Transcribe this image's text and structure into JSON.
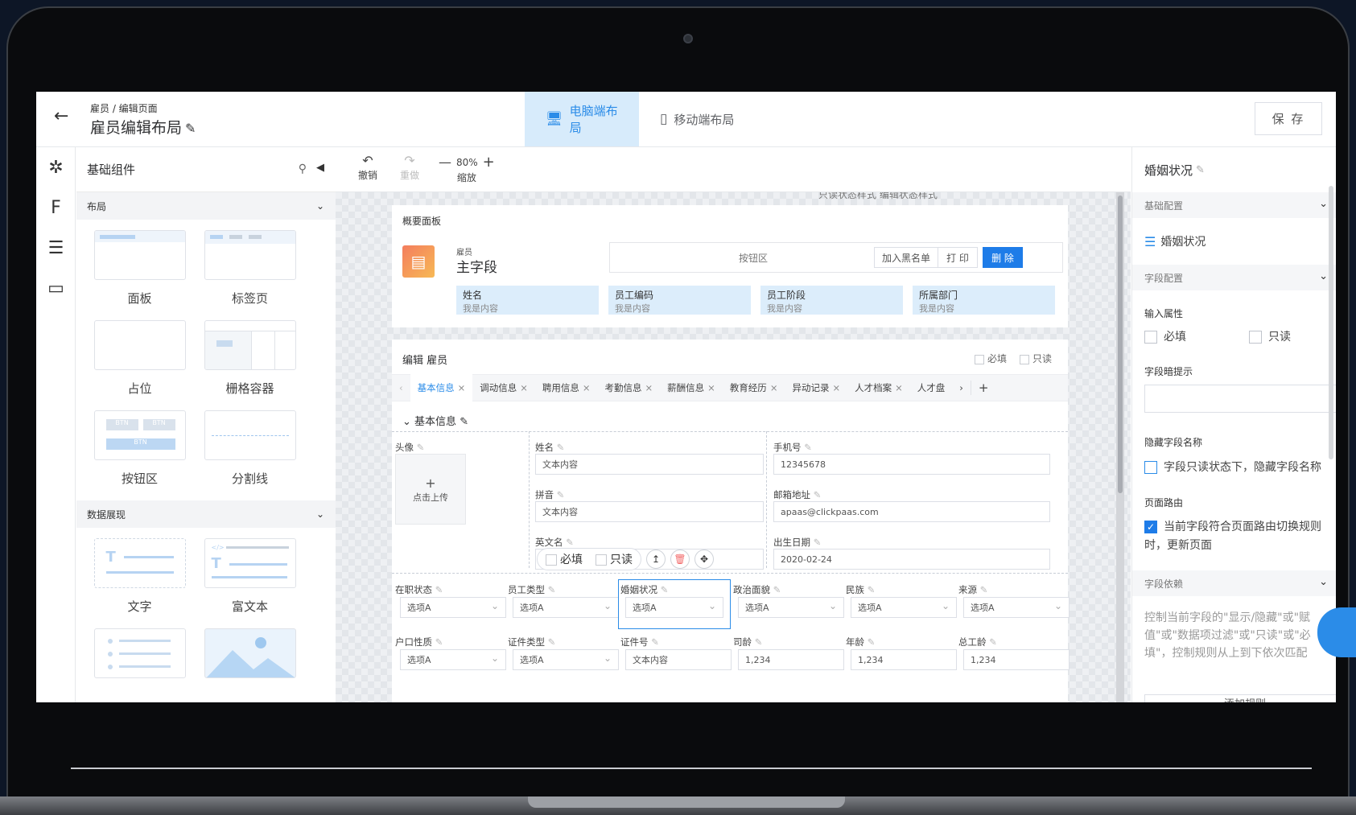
{
  "header": {
    "breadcrumb": "雇员 / 编辑页面",
    "title": "雇员编辑布局",
    "tabs": [
      {
        "label": "电脑端布局",
        "active": true
      },
      {
        "label": "移动端布局",
        "active": false
      }
    ],
    "save_label": "保 存"
  },
  "left_panel": {
    "title": "基础组件",
    "sections": [
      {
        "label": "布局",
        "items": [
          "面板",
          "标签页",
          "占位",
          "栅格容器",
          "按钮区",
          "分割线"
        ]
      },
      {
        "label": "数据展现",
        "items": [
          "文字",
          "富文本",
          "",
          ""
        ]
      }
    ]
  },
  "toolbar": {
    "undo": "撤销",
    "redo": "重做",
    "zoom_value": "80%",
    "zoom_label": "缩放"
  },
  "canvas": {
    "style_toggle": "只读状态样式   编辑状态样式",
    "overview": {
      "title": "概要面板",
      "entity": "雇员",
      "main_field": "主字段",
      "button_area": "按钮区",
      "buttons": [
        "加入黑名单",
        "打 印",
        "删 除"
      ],
      "fields": [
        {
          "label": "姓名",
          "value": "我是内容"
        },
        {
          "label": "员工编码",
          "value": "我是内容"
        },
        {
          "label": "员工阶段",
          "value": "我是内容"
        },
        {
          "label": "所属部门",
          "value": "我是内容"
        }
      ]
    },
    "edit": {
      "title": "编辑 雇员",
      "required": "必填",
      "readonly": "只读",
      "tabs": [
        "基本信息",
        "调动信息",
        "聘用信息",
        "考勤信息",
        "薪酬信息",
        "教育经历",
        "异动记录",
        "人才档案",
        "人才盘"
      ],
      "section": "基本信息",
      "avatar_label": "头像",
      "upload_text": "点击上传",
      "fields": {
        "name": {
          "label": "姓名",
          "value": "文本内容"
        },
        "phone": {
          "label": "手机号",
          "value": "12345678"
        },
        "pinyin": {
          "label": "拼音",
          "value": "文本内容"
        },
        "email": {
          "label": "邮箱地址",
          "value": "apaas@clickpaas.com"
        },
        "english": {
          "label": "英文名"
        },
        "birth": {
          "label": "出生日期",
          "value": "2020-02-24"
        }
      },
      "float_required": "必填",
      "float_readonly": "只读",
      "row1": [
        {
          "label": "在职状态",
          "value": "选项A"
        },
        {
          "label": "员工类型",
          "value": "选项A"
        },
        {
          "label": "婚姻状况",
          "value": "选项A"
        },
        {
          "label": "政治面貌",
          "value": "选项A"
        },
        {
          "label": "民族",
          "value": "选项A"
        },
        {
          "label": "来源",
          "value": "选项A"
        }
      ],
      "row2": [
        {
          "label": "户口性质",
          "value": "选项A"
        },
        {
          "label": "证件类型",
          "value": "选项A"
        },
        {
          "label": "证件号",
          "value": "文本内容"
        },
        {
          "label": "司龄",
          "value": "1,234"
        },
        {
          "label": "年龄",
          "value": "1,234"
        },
        {
          "label": "总工龄",
          "value": "1,234"
        }
      ]
    }
  },
  "right_panel": {
    "title": "婚姻状况",
    "basic_config": "基础配置",
    "field_name": "婚姻状况",
    "field_config": "字段配置",
    "input_attr": "输入属性",
    "required": "必填",
    "readonly": "只读",
    "hint_label": "字段暗提示",
    "hide_name_label": "隐藏字段名称",
    "hide_name_option": "字段只读状态下，隐藏字段名称",
    "route_label": "页面路由",
    "route_option": "当前字段符合页面路由切换规则时，更新页面",
    "dependency": "字段依赖",
    "dependency_desc": "控制当前字段的\"显示/隐藏\"或\"赋值\"或\"数据项过滤\"或\"只读\"或\"必填\"，控制规则从上到下依次匹配",
    "add_rule": "添加规则"
  }
}
